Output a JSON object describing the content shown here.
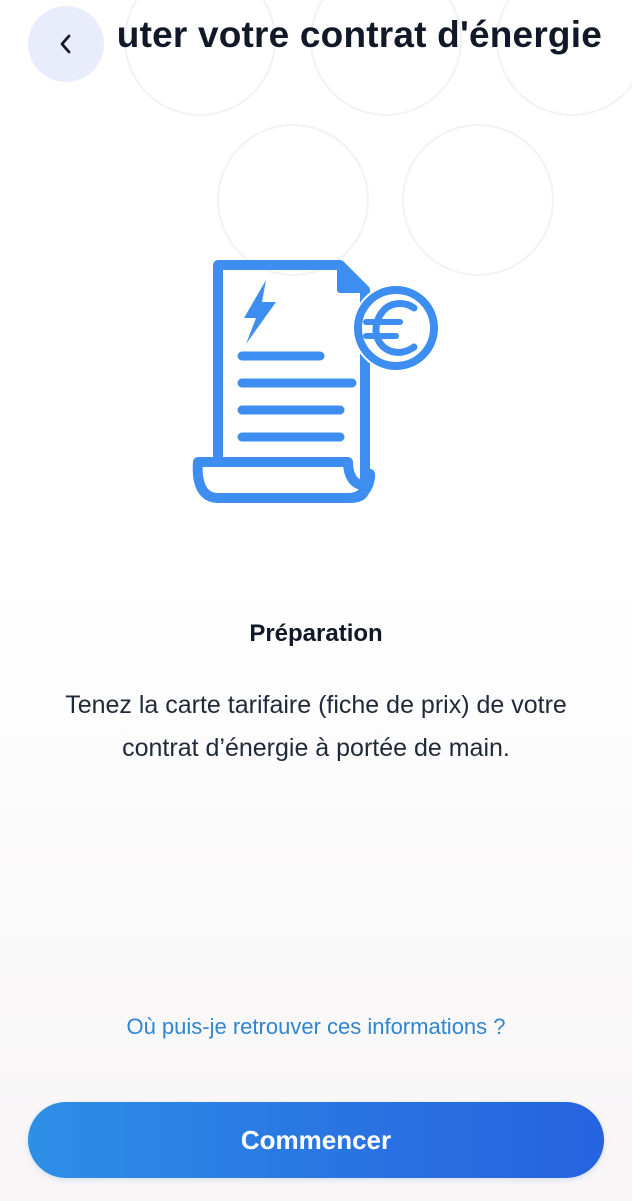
{
  "header": {
    "title": "uter votre contrat d'énergie",
    "back_icon": "chevron-left-icon"
  },
  "illustration": {
    "icon": "energy-contract-document-icon",
    "accent_color": "#3d8ef0"
  },
  "content": {
    "title": "Préparation",
    "description": "Tenez la carte tarifaire (fiche de prix) de votre contrat d’énergie à portée de main."
  },
  "link": {
    "label": "Où puis-je retrouver ces informations ?"
  },
  "actions": {
    "start_label": "Commencer"
  },
  "colors": {
    "primary": "#2a74e2",
    "link": "#2f86cf",
    "back_button_bg": "#e9edfb"
  }
}
